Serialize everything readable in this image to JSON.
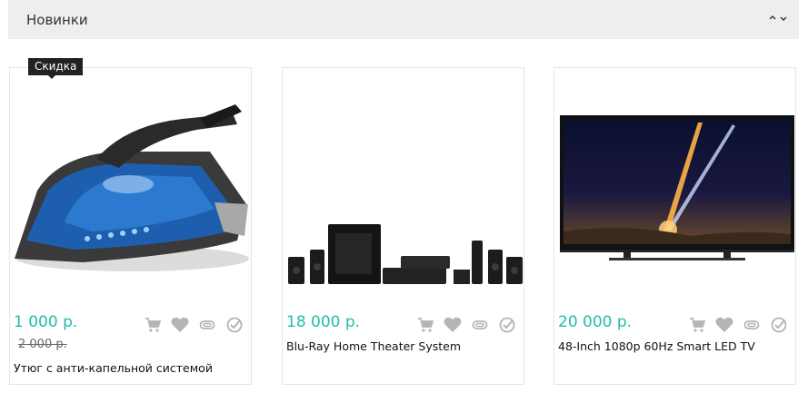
{
  "section": {
    "title": "Новинки",
    "arrow_up": "⌃",
    "arrow_down": "⌄"
  },
  "colors": {
    "price": "#1fbfa4",
    "icon": "#b5b5b5",
    "header_bg": "#eeeeee"
  },
  "products": [
    {
      "badge": "Скидка",
      "price": "1 000 р.",
      "old_price": "2 000 р.",
      "name": "Утюг с анти-капельной системой",
      "image": "steam-iron"
    },
    {
      "price": "18 000 р.",
      "name": "Blu-Ray Home Theater System",
      "image": "home-theater"
    },
    {
      "price": "20 000 р.",
      "name": "48-Inch 1080p 60Hz Smart LED TV",
      "image": "led-tv"
    }
  ],
  "action_icons": [
    "cart-icon",
    "heart-icon",
    "paperclip-icon",
    "check-circle-icon"
  ]
}
